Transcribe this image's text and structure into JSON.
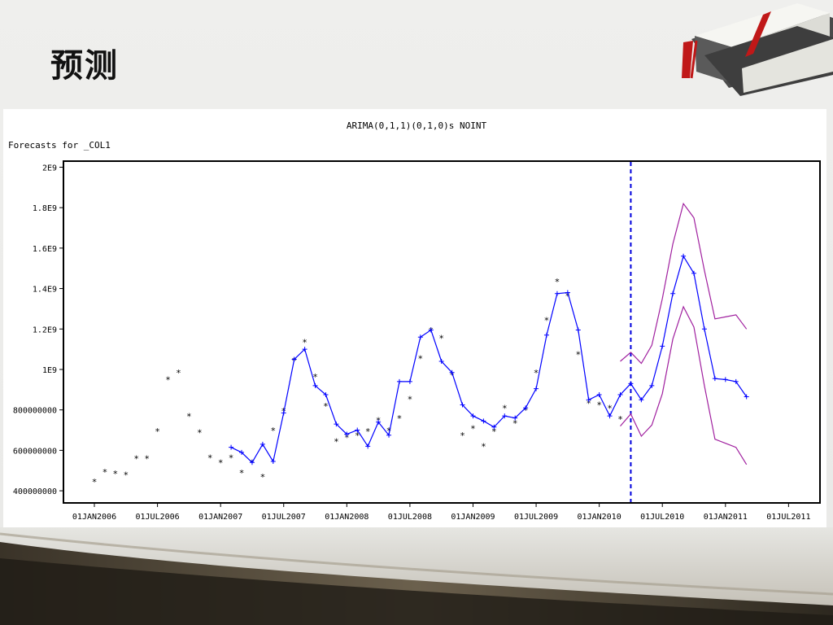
{
  "slide": {
    "title": "预测"
  },
  "chart_data": {
    "type": "line",
    "title": "ARIMA(0,1,1)(0,1,0)s NOINT",
    "subtitle": "Forecasts for _COL1",
    "xlabel": "",
    "ylabel": "",
    "x_ticks": [
      "01JAN2006",
      "01JUL2006",
      "01JAN2007",
      "01JUL2007",
      "01JAN2008",
      "01JUL2008",
      "01JAN2009",
      "01JUL2009",
      "01JAN2010",
      "01JUL2010",
      "01JAN2011",
      "01JUL2011"
    ],
    "y_ticks": [
      "400000000",
      "600000000",
      "800000000",
      "1E9",
      "1.2E9",
      "1.4E9",
      "1.6E9",
      "1.8E9",
      "2E9"
    ],
    "y_tick_values": [
      400000000,
      600000000,
      800000000,
      1000000000,
      1200000000,
      1400000000,
      1600000000,
      1800000000,
      2000000000
    ],
    "ylim": [
      340000000,
      2030000000
    ],
    "grid": false,
    "forecast_start": "2010-04",
    "series": [
      {
        "marker": "*",
        "color": "#000000",
        "points": [
          [
            "2006-01",
            460000000
          ],
          [
            "2006-02",
            510000000
          ],
          [
            "2006-03",
            500000000
          ],
          [
            "2006-04",
            495000000
          ],
          [
            "2006-05",
            575000000
          ],
          [
            "2006-06",
            575000000
          ],
          [
            "2006-07",
            710000000
          ],
          [
            "2006-08",
            965000000
          ],
          [
            "2006-09",
            1000000000
          ],
          [
            "2006-10",
            785000000
          ],
          [
            "2006-11",
            705000000
          ],
          [
            "2006-12",
            580000000
          ],
          [
            "2007-01",
            555000000
          ],
          [
            "2007-02",
            580000000
          ],
          [
            "2007-03",
            505000000
          ],
          [
            "2007-04",
            555000000
          ],
          [
            "2007-05",
            485000000
          ],
          [
            "2007-06",
            715000000
          ],
          [
            "2007-07",
            810000000
          ],
          [
            "2007-08",
            1060000000
          ],
          [
            "2007-09",
            1150000000
          ],
          [
            "2007-10",
            980000000
          ],
          [
            "2007-11",
            835000000
          ],
          [
            "2007-12",
            660000000
          ],
          [
            "2008-01",
            680000000
          ],
          [
            "2008-02",
            690000000
          ],
          [
            "2008-03",
            710000000
          ],
          [
            "2008-04",
            765000000
          ],
          [
            "2008-05",
            715000000
          ],
          [
            "2008-06",
            775000000
          ],
          [
            "2008-07",
            870000000
          ],
          [
            "2008-08",
            1070000000
          ],
          [
            "2008-09",
            1210000000
          ],
          [
            "2008-10",
            1170000000
          ],
          [
            "2008-11",
            990000000
          ],
          [
            "2008-12",
            690000000
          ],
          [
            "2009-01",
            725000000
          ],
          [
            "2009-02",
            635000000
          ],
          [
            "2009-03",
            710000000
          ],
          [
            "2009-04",
            825000000
          ],
          [
            "2009-05",
            750000000
          ],
          [
            "2009-06",
            815000000
          ],
          [
            "2009-07",
            1000000000
          ],
          [
            "2009-08",
            1260000000
          ],
          [
            "2009-09",
            1450000000
          ],
          [
            "2009-10",
            1380000000
          ],
          [
            "2009-11",
            1090000000
          ],
          [
            "2009-12",
            850000000
          ],
          [
            "2010-01",
            840000000
          ],
          [
            "2010-02",
            825000000
          ],
          [
            "2010-03",
            770000000
          ]
        ]
      },
      {
        "marker": "+",
        "color": "#0000ff",
        "points": [
          [
            "2007-02",
            615000000
          ],
          [
            "2007-03",
            590000000
          ],
          [
            "2007-04",
            540000000
          ],
          [
            "2007-05",
            630000000
          ],
          [
            "2007-06",
            545000000
          ],
          [
            "2007-07",
            785000000
          ],
          [
            "2007-08",
            1050000000
          ],
          [
            "2007-09",
            1100000000
          ],
          [
            "2007-10",
            920000000
          ],
          [
            "2007-11",
            875000000
          ],
          [
            "2007-12",
            730000000
          ],
          [
            "2008-01",
            680000000
          ],
          [
            "2008-02",
            700000000
          ],
          [
            "2008-03",
            620000000
          ],
          [
            "2008-04",
            740000000
          ],
          [
            "2008-05",
            675000000
          ],
          [
            "2008-06",
            940000000
          ],
          [
            "2008-07",
            940000000
          ],
          [
            "2008-08",
            1160000000
          ],
          [
            "2008-09",
            1195000000
          ],
          [
            "2008-10",
            1040000000
          ],
          [
            "2008-11",
            985000000
          ],
          [
            "2008-12",
            825000000
          ],
          [
            "2009-01",
            770000000
          ],
          [
            "2009-02",
            745000000
          ],
          [
            "2009-03",
            715000000
          ],
          [
            "2009-04",
            770000000
          ],
          [
            "2009-05",
            760000000
          ],
          [
            "2009-06",
            810000000
          ],
          [
            "2009-07",
            905000000
          ],
          [
            "2009-08",
            1170000000
          ],
          [
            "2009-09",
            1375000000
          ],
          [
            "2009-10",
            1380000000
          ],
          [
            "2009-11",
            1195000000
          ],
          [
            "2009-12",
            850000000
          ],
          [
            "2010-01",
            875000000
          ],
          [
            "2010-02",
            770000000
          ],
          [
            "2010-03",
            875000000
          ],
          [
            "2010-04",
            930000000
          ],
          [
            "2010-05",
            850000000
          ],
          [
            "2010-06",
            920000000
          ],
          [
            "2010-07",
            1115000000
          ],
          [
            "2010-08",
            1375000000
          ],
          [
            "2010-09",
            1560000000
          ],
          [
            "2010-10",
            1475000000
          ],
          [
            "2010-11",
            1200000000
          ],
          [
            "2010-12",
            955000000
          ],
          [
            "2011-01",
            950000000
          ],
          [
            "2011-02",
            940000000
          ],
          [
            "2011-03",
            865000000
          ]
        ]
      },
      {
        "color": "#a0209f",
        "points": [
          [
            "2010-03",
            1040000000
          ],
          [
            "2010-04",
            1085000000
          ],
          [
            "2010-05",
            1030000000
          ],
          [
            "2010-06",
            1120000000
          ],
          [
            "2010-07",
            1350000000
          ],
          [
            "2010-08",
            1620000000
          ],
          [
            "2010-09",
            1820000000
          ],
          [
            "2010-10",
            1750000000
          ],
          [
            "2010-11",
            1490000000
          ],
          [
            "2010-12",
            1250000000
          ],
          [
            "2011-01",
            1260000000
          ],
          [
            "2011-02",
            1270000000
          ],
          [
            "2011-03",
            1200000000
          ]
        ]
      },
      {
        "color": "#a0209f",
        "points": [
          [
            "2010-03",
            720000000
          ],
          [
            "2010-04",
            780000000
          ],
          [
            "2010-05",
            670000000
          ],
          [
            "2010-06",
            725000000
          ],
          [
            "2010-07",
            880000000
          ],
          [
            "2010-08",
            1150000000
          ],
          [
            "2010-09",
            1310000000
          ],
          [
            "2010-10",
            1210000000
          ],
          [
            "2010-11",
            920000000
          ],
          [
            "2010-12",
            655000000
          ],
          [
            "2011-01",
            635000000
          ],
          [
            "2011-02",
            615000000
          ],
          [
            "2011-03",
            530000000
          ]
        ]
      }
    ]
  }
}
